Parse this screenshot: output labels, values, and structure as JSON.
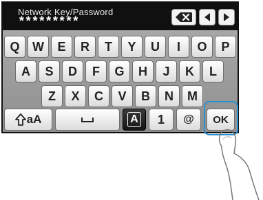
{
  "entry": {
    "label": "Network Key/Password",
    "value": "*********"
  },
  "controls": {
    "backspace_icon": "backspace-icon",
    "left_icon": "arrow-left-icon",
    "right_icon": "arrow-right-icon"
  },
  "rows": {
    "row1": [
      "Q",
      "W",
      "E",
      "R",
      "T",
      "Y",
      "U",
      "I",
      "O",
      "P"
    ],
    "row2": [
      "A",
      "S",
      "D",
      "F",
      "G",
      "H",
      "J",
      "K",
      "L"
    ],
    "row3": [
      "Z",
      "X",
      "C",
      "V",
      "B",
      "N",
      "M"
    ]
  },
  "bottom": {
    "shift_label": "aA",
    "mode_a": "A",
    "mode_1": "1",
    "mode_at": "@",
    "ok": "OK"
  },
  "colors": {
    "highlight": "#2a8fd0"
  }
}
